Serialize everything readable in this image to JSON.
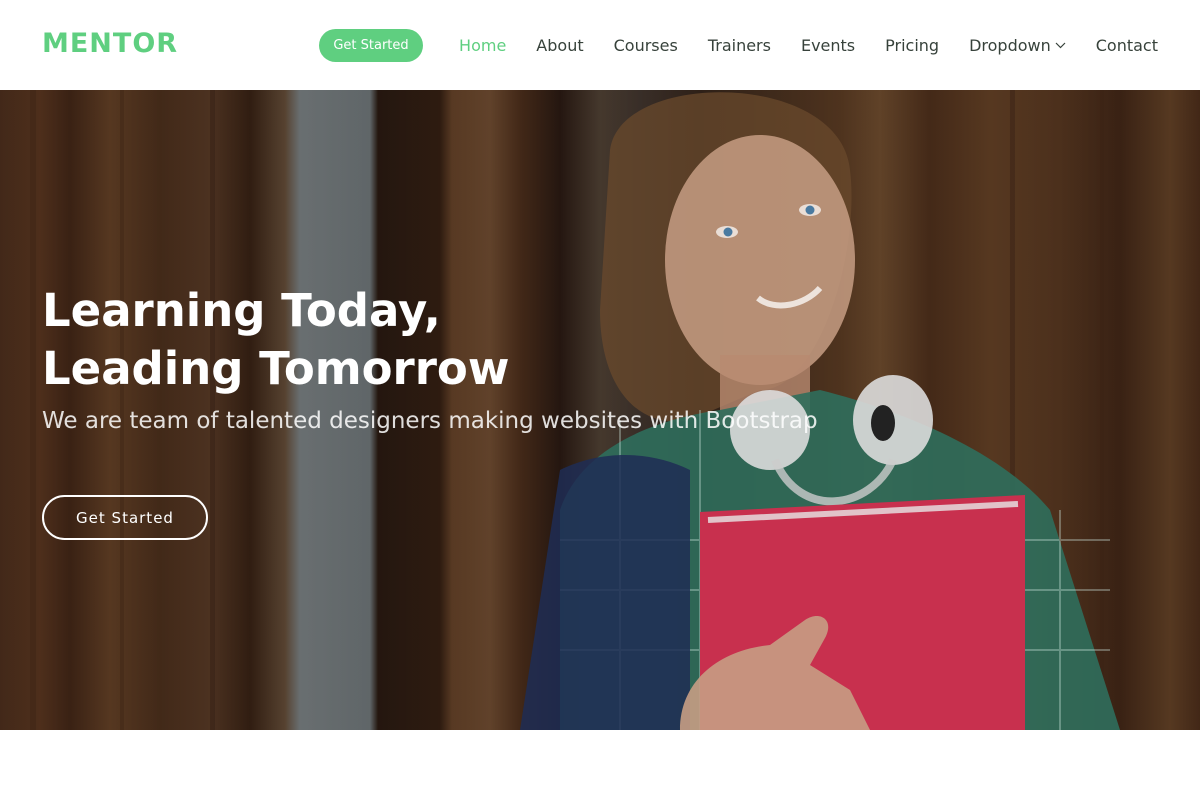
{
  "brand": {
    "logo": "MENTOR",
    "accent": "#5fcf80",
    "text_color": "#37423b"
  },
  "header": {
    "cta_label": "Get Started",
    "nav": [
      {
        "label": "Home",
        "active": true
      },
      {
        "label": "About"
      },
      {
        "label": "Courses"
      },
      {
        "label": "Trainers"
      },
      {
        "label": "Events"
      },
      {
        "label": "Pricing"
      },
      {
        "label": "Dropdown",
        "icon": "chevron-down-icon"
      },
      {
        "label": "Contact"
      }
    ]
  },
  "hero": {
    "title_line1": "Learning Today,",
    "title_line2": "Leading Tomorrow",
    "subtitle": "We are team of talented designers making websites with Bootstrap",
    "button_label": "Get Started"
  }
}
